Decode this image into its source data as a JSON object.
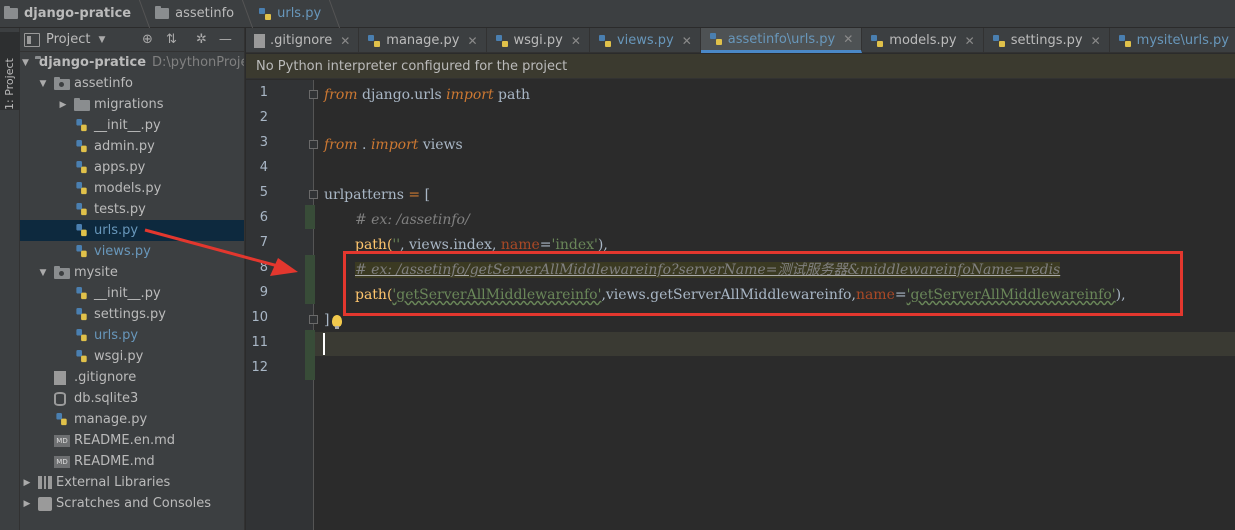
{
  "breadcrumb": {
    "project": "django-pratice",
    "folder": "assetinfo",
    "file": "urls.py"
  },
  "toolstrip": {
    "project_tab": "1: Project"
  },
  "project_panel": {
    "title": "Project",
    "tree": [
      {
        "label": "django-pratice",
        "path": "D:\\pythonProject",
        "icon": "project-folder-icon",
        "depth": 0,
        "expanded": true,
        "bold": true
      },
      {
        "label": "assetinfo",
        "icon": "folder-icon",
        "depth": 1,
        "expanded": true
      },
      {
        "label": "migrations",
        "icon": "folder-icon",
        "depth": 2,
        "expanded": false
      },
      {
        "label": "__init__.py",
        "icon": "python-file-icon",
        "depth": 2
      },
      {
        "label": "admin.py",
        "icon": "python-file-icon",
        "depth": 2
      },
      {
        "label": "apps.py",
        "icon": "python-file-icon",
        "depth": 2
      },
      {
        "label": "models.py",
        "icon": "python-file-icon",
        "depth": 2
      },
      {
        "label": "tests.py",
        "icon": "python-file-icon",
        "depth": 2
      },
      {
        "label": "urls.py",
        "icon": "python-file-icon",
        "depth": 2,
        "selected": true,
        "modified": true
      },
      {
        "label": "views.py",
        "icon": "python-file-icon",
        "depth": 2,
        "modified": true
      },
      {
        "label": "mysite",
        "icon": "folder-icon",
        "depth": 1,
        "expanded": true
      },
      {
        "label": "__init__.py",
        "icon": "python-file-icon",
        "depth": 2
      },
      {
        "label": "settings.py",
        "icon": "python-file-icon",
        "depth": 2
      },
      {
        "label": "urls.py",
        "icon": "python-file-icon",
        "depth": 2,
        "modified": true
      },
      {
        "label": "wsgi.py",
        "icon": "python-file-icon",
        "depth": 2
      },
      {
        "label": ".gitignore",
        "icon": "text-file-icon",
        "depth": 1
      },
      {
        "label": "db.sqlite3",
        "icon": "database-file-icon",
        "depth": 1
      },
      {
        "label": "manage.py",
        "icon": "python-file-icon",
        "depth": 1
      },
      {
        "label": "README.en.md",
        "icon": "markdown-file-icon",
        "depth": 1
      },
      {
        "label": "README.md",
        "icon": "markdown-file-icon",
        "depth": 1
      },
      {
        "label": "External Libraries",
        "icon": "library-icon",
        "depth": 0,
        "expanded": false
      },
      {
        "label": "Scratches and Consoles",
        "icon": "scratches-icon",
        "depth": 0,
        "expanded": false
      }
    ]
  },
  "tabs": [
    {
      "label": ".gitignore",
      "icon": "text-file-icon"
    },
    {
      "label": "manage.py",
      "icon": "python-file-icon"
    },
    {
      "label": "wsgi.py",
      "icon": "python-file-icon"
    },
    {
      "label": "views.py",
      "icon": "python-file-icon",
      "modified": true
    },
    {
      "label": "assetinfo\\urls.py",
      "icon": "python-file-icon",
      "modified": true,
      "active": true
    },
    {
      "label": "models.py",
      "icon": "python-file-icon"
    },
    {
      "label": "settings.py",
      "icon": "python-file-icon"
    },
    {
      "label": "mysite\\urls.py",
      "icon": "python-file-icon",
      "modified": true
    }
  ],
  "banner": {
    "message": "No Python interpreter configured for the project"
  },
  "editor": {
    "line_numbers": [
      "1",
      "2",
      "3",
      "4",
      "5",
      "6",
      "7",
      "8",
      "9",
      "10",
      "11",
      "12"
    ],
    "code": {
      "l1": {
        "kw1": "from",
        "mod": " django.urls ",
        "kw2": "import",
        "name": " path"
      },
      "l3": {
        "kw1": "from",
        "mod": " . ",
        "kw2": "import",
        "name": " views"
      },
      "l5": {
        "var": "urlpatterns",
        "eq": " = ",
        "open": "["
      },
      "l6": {
        "comment": "# ex: /assetinfo/"
      },
      "l7": {
        "fn": "path(",
        "s1": "''",
        "mid": ", views.index, ",
        "kwarg": "name",
        "eq": "=",
        "s2": "'index'",
        "end": "),"
      },
      "l8": {
        "comment": "# ex: /assetinfo/getServerAllMiddlewareinfo?serverName=测试服务器&middlewareinfoName=redis"
      },
      "l9": {
        "fn": "path(",
        "s1": "'getServerAllMiddlewareinfo'",
        "mid": ",views.getServerAllMiddlewareinfo,",
        "kwarg": "name",
        "eq": "=",
        "s2": "'getServerAllMiddlewareinfo'",
        "end": "),"
      },
      "l10": {
        "close": "]"
      }
    }
  },
  "colors": {
    "keyword": "#cc7832",
    "string": "#6a8759",
    "comment": "#808080",
    "kwarg": "#aa4926",
    "annotation": "#e3372e",
    "selection": "#0d293e"
  }
}
